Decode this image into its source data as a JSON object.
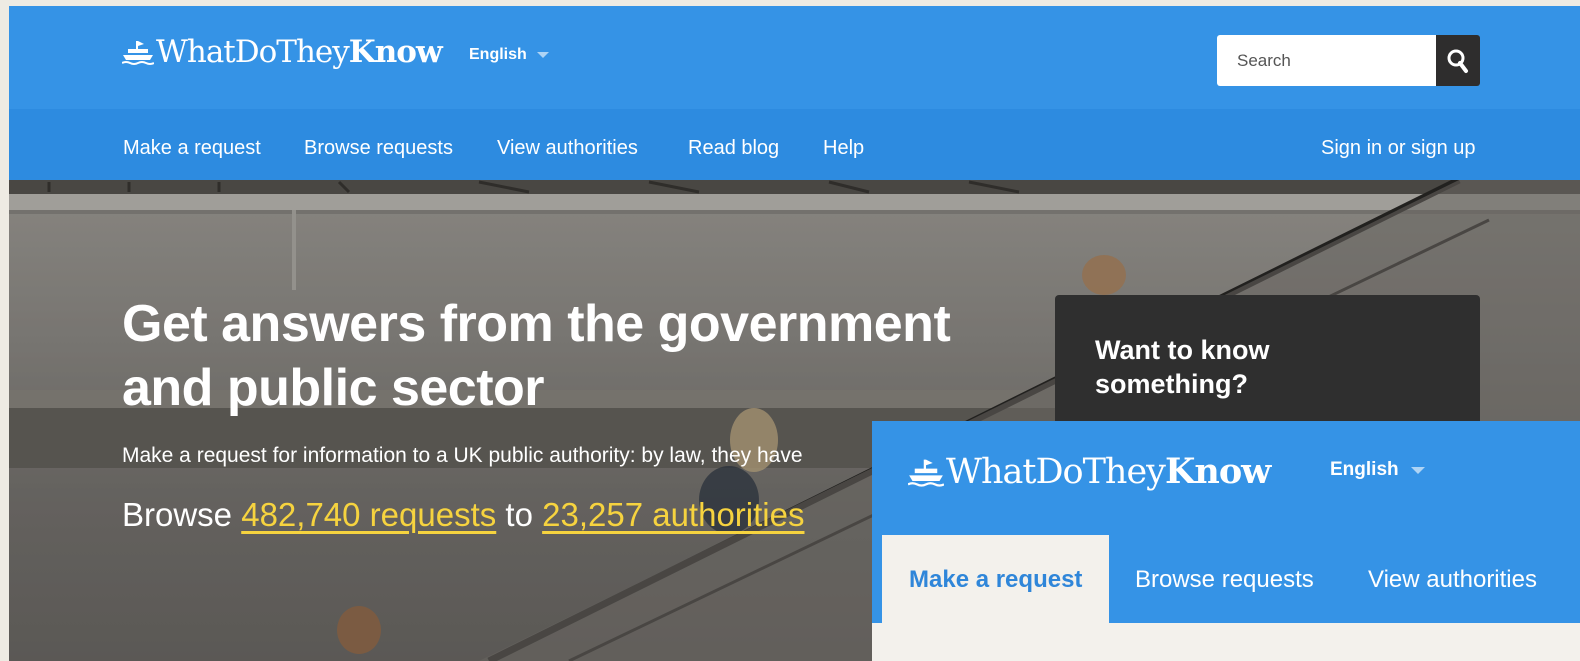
{
  "site": {
    "logo_light": "WhatDoThey",
    "logo_bold": "Know",
    "language": "English"
  },
  "search": {
    "placeholder": "Search"
  },
  "nav": {
    "make_request": "Make a request",
    "browse_requests": "Browse requests",
    "view_authorities": "View authorities",
    "read_blog": "Read blog",
    "help": "Help",
    "sign_in": "Sign in or sign up"
  },
  "hero": {
    "title": "Get answers from the government and public sector",
    "subtitle": "Make a request for information to a UK public authority: by law, they have",
    "browse_prefix": "Browse",
    "requests_link": "482,740 requests",
    "browse_middle": "to",
    "authorities_link": "23,257 authorities"
  },
  "know_card": {
    "title": "Want to know something?"
  },
  "inset": {
    "logo_light": "WhatDoThey",
    "logo_bold": "Know",
    "language": "English",
    "tabs": [
      "Make a request",
      "Browse requests",
      "View authorities"
    ]
  },
  "colors": {
    "brand_blue": "#3593e6",
    "nav_blue": "#2d8be0",
    "link_yellow": "#f6d33f",
    "dark_card": "#2f2f2f",
    "page_bg": "#eeebe3"
  },
  "icons": [
    "ship-logo-icon",
    "chevron-down-icon",
    "search-icon"
  ]
}
